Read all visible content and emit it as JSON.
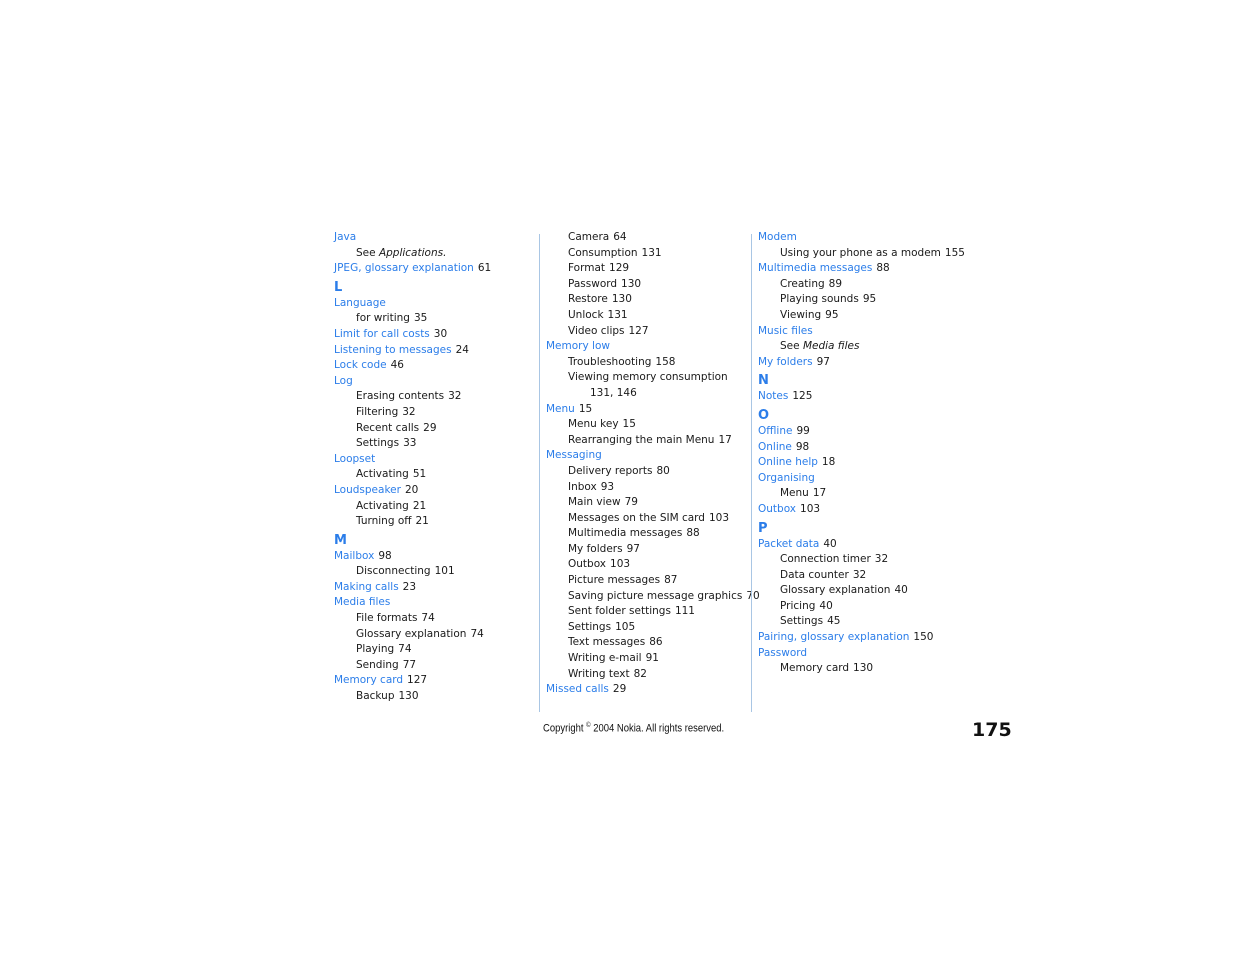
{
  "colors": {
    "link": "#2b7de9",
    "divider": "#a9c6e4",
    "text": "#1a1a1a"
  },
  "columns": [
    [
      {
        "type": "main",
        "term": "Java"
      },
      {
        "type": "see",
        "prefix": "See",
        "target": "Applications."
      },
      {
        "type": "main",
        "term": "JPEG, glossary explanation",
        "pages": "61"
      },
      {
        "type": "letter",
        "text": "L"
      },
      {
        "type": "main",
        "term": "Language"
      },
      {
        "type": "sub",
        "term": "for writing",
        "pages": "35"
      },
      {
        "type": "main",
        "term": "Limit for call costs",
        "pages": "30"
      },
      {
        "type": "main",
        "term": "Listening to messages",
        "pages": "24"
      },
      {
        "type": "main",
        "term": "Lock code",
        "pages": "46"
      },
      {
        "type": "main",
        "term": "Log"
      },
      {
        "type": "sub",
        "term": "Erasing contents",
        "pages": "32"
      },
      {
        "type": "sub",
        "term": "Filtering",
        "pages": "32"
      },
      {
        "type": "sub",
        "term": "Recent calls",
        "pages": "29"
      },
      {
        "type": "sub",
        "term": "Settings",
        "pages": "33"
      },
      {
        "type": "main",
        "term": "Loopset"
      },
      {
        "type": "sub",
        "term": "Activating",
        "pages": "51"
      },
      {
        "type": "main",
        "term": "Loudspeaker",
        "pages": "20"
      },
      {
        "type": "sub",
        "term": "Activating",
        "pages": "21"
      },
      {
        "type": "sub",
        "term": "Turning off",
        "pages": "21"
      },
      {
        "type": "letter",
        "text": "M"
      },
      {
        "type": "main",
        "term": "Mailbox",
        "pages": "98"
      },
      {
        "type": "sub",
        "term": "Disconnecting",
        "pages": "101"
      },
      {
        "type": "main",
        "term": "Making calls",
        "pages": "23"
      },
      {
        "type": "main",
        "term": "Media files"
      },
      {
        "type": "sub",
        "term": "File formats",
        "pages": "74"
      },
      {
        "type": "sub",
        "term": "Glossary explanation",
        "pages": "74"
      },
      {
        "type": "sub",
        "term": "Playing",
        "pages": "74"
      },
      {
        "type": "sub",
        "term": "Sending",
        "pages": "77"
      },
      {
        "type": "main",
        "term": "Memory card",
        "pages": "127"
      },
      {
        "type": "sub",
        "term": "Backup",
        "pages": "130"
      }
    ],
    [
      {
        "type": "sub",
        "term": "Camera",
        "pages": "64"
      },
      {
        "type": "sub",
        "term": "Consumption",
        "pages": "131"
      },
      {
        "type": "sub",
        "term": "Format",
        "pages": "129"
      },
      {
        "type": "sub",
        "term": "Password",
        "pages": "130"
      },
      {
        "type": "sub",
        "term": "Restore",
        "pages": "130"
      },
      {
        "type": "sub",
        "term": "Unlock",
        "pages": "131"
      },
      {
        "type": "sub",
        "term": "Video clips",
        "pages": "127"
      },
      {
        "type": "main",
        "term": "Memory low"
      },
      {
        "type": "sub",
        "term": "Troubleshooting",
        "pages": "158"
      },
      {
        "type": "sub",
        "term": "Viewing memory consumption"
      },
      {
        "type": "sub2",
        "term": "131, 146"
      },
      {
        "type": "main",
        "term": "Menu",
        "pages": "15"
      },
      {
        "type": "sub",
        "term": "Menu key",
        "pages": "15"
      },
      {
        "type": "sub",
        "term": "Rearranging the main Menu",
        "pages": "17"
      },
      {
        "type": "main",
        "term": "Messaging"
      },
      {
        "type": "sub",
        "term": "Delivery reports",
        "pages": "80"
      },
      {
        "type": "sub",
        "term": "Inbox",
        "pages": "93"
      },
      {
        "type": "sub",
        "term": "Main view",
        "pages": "79"
      },
      {
        "type": "sub",
        "term": "Messages on the SIM card",
        "pages": "103"
      },
      {
        "type": "sub",
        "term": "Multimedia messages",
        "pages": "88"
      },
      {
        "type": "sub",
        "term": "My folders",
        "pages": "97"
      },
      {
        "type": "sub",
        "term": "Outbox",
        "pages": "103"
      },
      {
        "type": "sub",
        "term": "Picture messages",
        "pages": "87"
      },
      {
        "type": "sub",
        "term": "Saving picture message graphics",
        "pages": "70"
      },
      {
        "type": "sub",
        "term": "Sent folder settings",
        "pages": "111"
      },
      {
        "type": "sub",
        "term": "Settings",
        "pages": "105"
      },
      {
        "type": "sub",
        "term": "Text messages",
        "pages": "86"
      },
      {
        "type": "sub",
        "term": "Writing e-mail",
        "pages": "91"
      },
      {
        "type": "sub",
        "term": "Writing text",
        "pages": "82"
      },
      {
        "type": "main",
        "term": "Missed calls",
        "pages": "29"
      }
    ],
    [
      {
        "type": "main",
        "term": "Modem"
      },
      {
        "type": "sub",
        "term": "Using your phone as a modem",
        "pages": "155"
      },
      {
        "type": "main",
        "term": "Multimedia messages",
        "pages": "88"
      },
      {
        "type": "sub",
        "term": "Creating",
        "pages": "89"
      },
      {
        "type": "sub",
        "term": "Playing sounds",
        "pages": "95"
      },
      {
        "type": "sub",
        "term": "Viewing",
        "pages": "95"
      },
      {
        "type": "main",
        "term": "Music files"
      },
      {
        "type": "see",
        "prefix": "See",
        "target": "Media files"
      },
      {
        "type": "main",
        "term": "My folders",
        "pages": "97"
      },
      {
        "type": "letter",
        "text": "N"
      },
      {
        "type": "main",
        "term": "Notes",
        "pages": "125"
      },
      {
        "type": "letter",
        "text": "O"
      },
      {
        "type": "main",
        "term": "Offline",
        "pages": "99"
      },
      {
        "type": "main",
        "term": "Online",
        "pages": "98"
      },
      {
        "type": "main",
        "term": "Online help",
        "pages": "18"
      },
      {
        "type": "main",
        "term": "Organising"
      },
      {
        "type": "sub",
        "term": "Menu",
        "pages": "17"
      },
      {
        "type": "main",
        "term": "Outbox",
        "pages": "103"
      },
      {
        "type": "letter",
        "text": "P"
      },
      {
        "type": "main",
        "term": "Packet data",
        "pages": "40"
      },
      {
        "type": "sub",
        "term": "Connection timer",
        "pages": "32"
      },
      {
        "type": "sub",
        "term": "Data counter",
        "pages": "32"
      },
      {
        "type": "sub",
        "term": "Glossary explanation",
        "pages": "40"
      },
      {
        "type": "sub",
        "term": "Pricing",
        "pages": "40"
      },
      {
        "type": "sub",
        "term": "Settings",
        "pages": "45"
      },
      {
        "type": "main",
        "term": "Pairing, glossary explanation",
        "pages": "150"
      },
      {
        "type": "main",
        "term": "Password"
      },
      {
        "type": "sub",
        "term": "Memory card",
        "pages": "130"
      }
    ]
  ],
  "footer": {
    "copyright_prefix": "Copyright",
    "copyright_symbol": "©",
    "copyright_rest": "2004 Nokia. All rights reserved.",
    "page_number": "175"
  }
}
